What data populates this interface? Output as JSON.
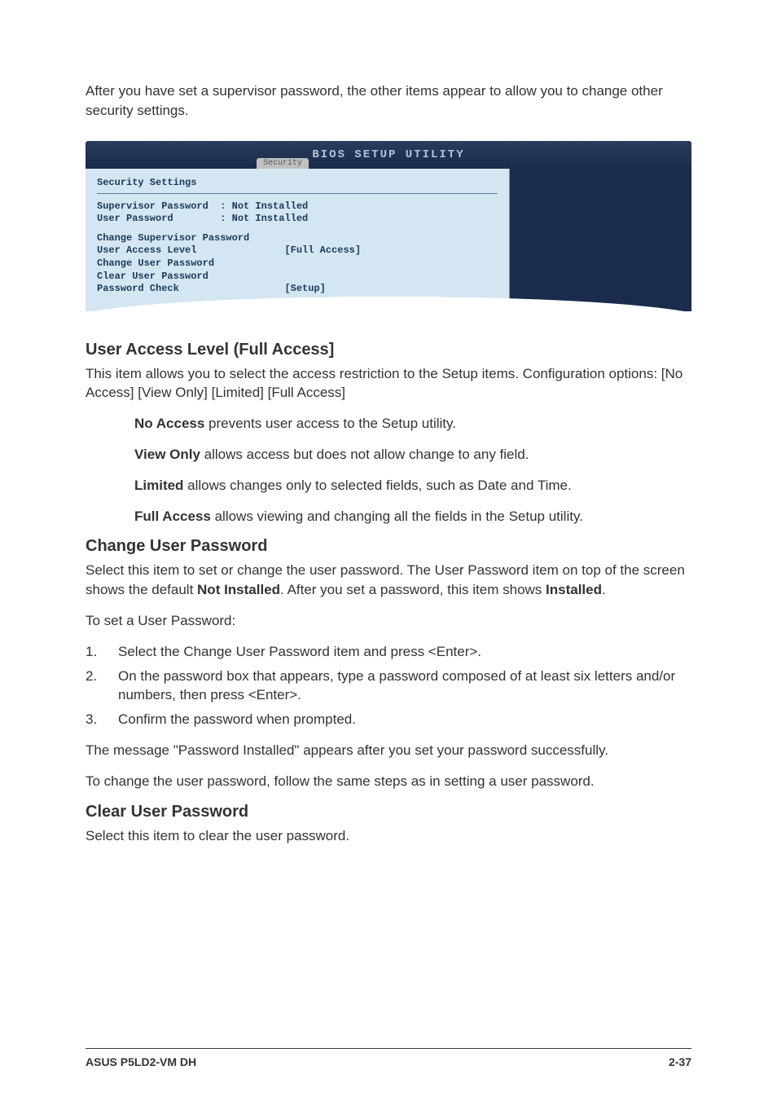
{
  "intro": "After you have set a supervisor password, the other items appear to allow you to change other security settings.",
  "bios": {
    "headerTitle": "BIOS SETUP UTILITY",
    "tab": "Security",
    "sectionTitle": "Security Settings",
    "line1": "Supervisor Password  : Not Installed",
    "line2": "User Password        : Not Installed",
    "line3": "Change Supervisor Password",
    "line4": "User Access Level               [Full Access]",
    "line5": "Change User Password",
    "line6": "Clear User Password",
    "line7": "Password Check                  [Setup]"
  },
  "section1": {
    "heading": "User Access Level (Full Access]",
    "body": "This item allows you to select the access restriction to the Setup items. Configuration options: [No Access] [View Only] [Limited] [Full Access]",
    "opt1Label": "No Access",
    "opt1Text": " prevents user access to the Setup utility.",
    "opt2Label": "View Only",
    "opt2Text": " allows access but does not allow change to any field.",
    "opt3Label": "Limited",
    "opt3Text": " allows changes only to selected fields, such as Date and Time.",
    "opt4Label": "Full Access",
    "opt4Text": " allows viewing and changing all the fields in the Setup utility."
  },
  "section2": {
    "heading": "Change User Password",
    "p1a": "Select this item to set or change the user password. The User Password item on top of the screen shows the default ",
    "p1b": "Not Installed",
    "p1c": ". After you set a password, this item shows ",
    "p1d": "Installed",
    "p1e": ".",
    "p2": "To set a User Password:",
    "li1": "Select the Change User Password item and press <Enter>.",
    "li2": "On the password box that appears, type a password composed of at least six letters and/or numbers, then press <Enter>.",
    "li3": "Confirm the password when prompted.",
    "p3": "The message \"Password Installed\" appears after you set your password successfully.",
    "p4": "To change the user password, follow the same steps as in setting a user password."
  },
  "section3": {
    "heading": "Clear User Password",
    "body": "Select this item to clear the user password."
  },
  "footer": {
    "left": "ASUS P5LD2-VM DH",
    "right": "2-37"
  }
}
